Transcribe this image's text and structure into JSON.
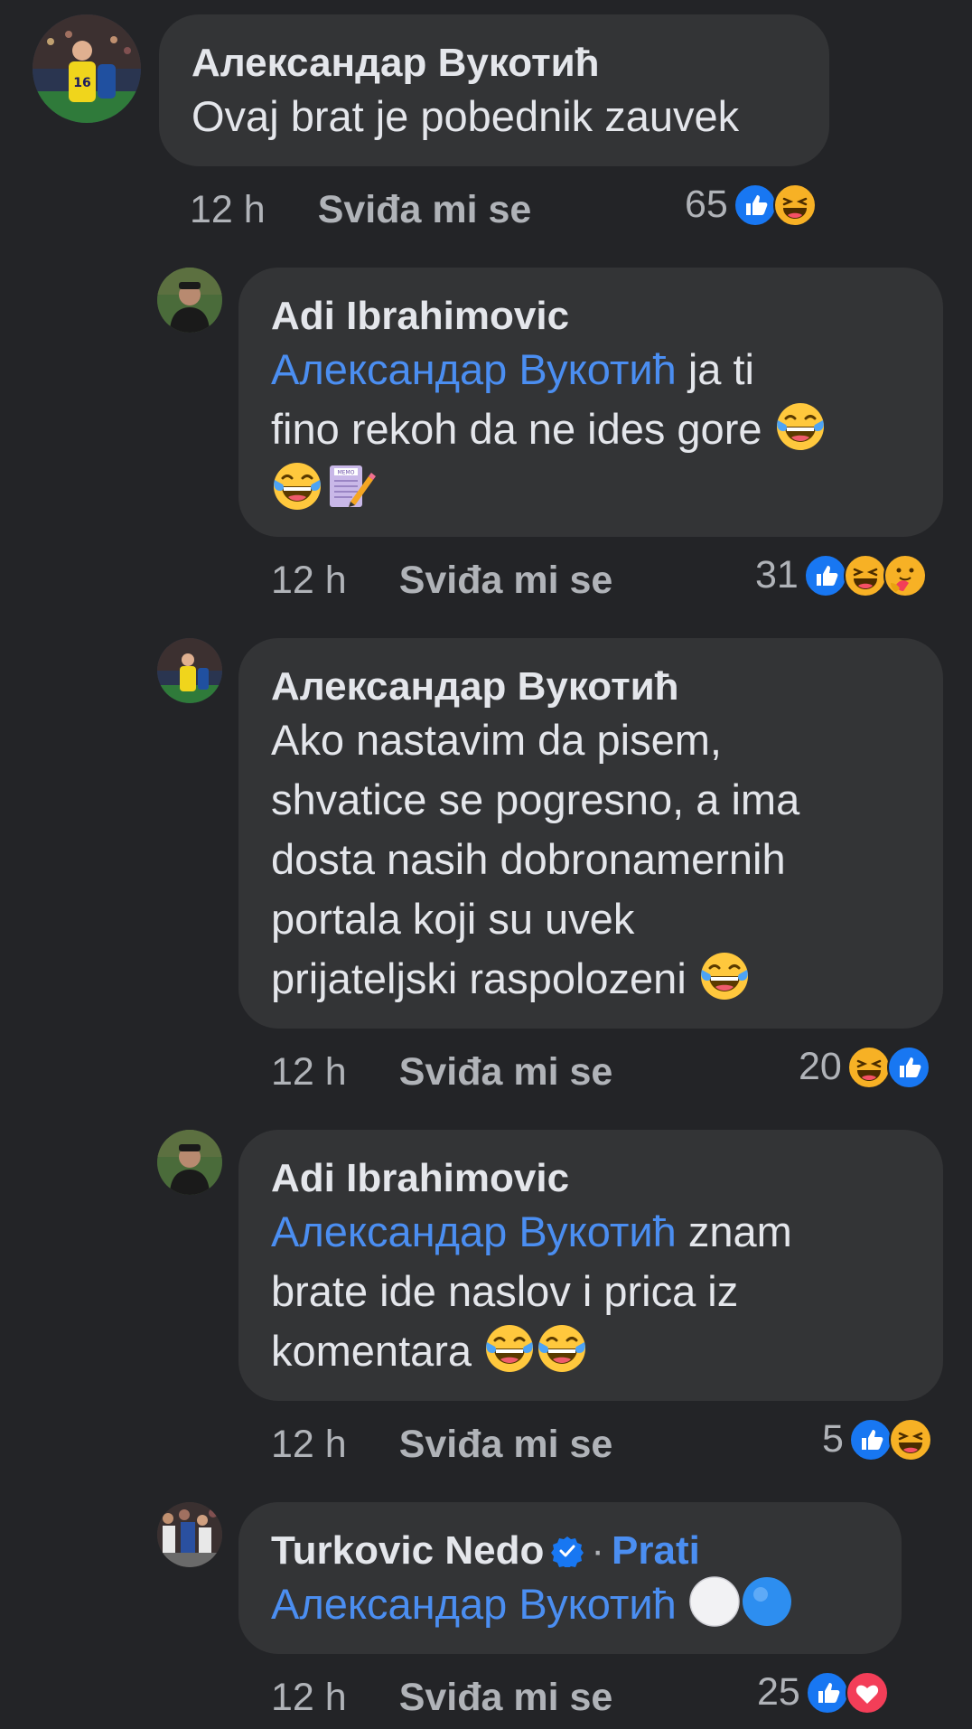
{
  "comments": [
    {
      "author": "Александар Вукотић",
      "text": "Ovaj brat je pobednik zauvek",
      "time": "12 h",
      "like_label": "Sviđa mi se",
      "reaction_count": "65",
      "reactions": [
        "like",
        "haha"
      ]
    },
    {
      "author": "Adi Ibrahimovic",
      "mention": "Александар Вукотић",
      "text_line1_after_mention": " ja ti",
      "text_line2": "fino rekoh da ne ides gore",
      "emojis": [
        "laughing-tears",
        "laughing-tears",
        "memo"
      ],
      "time": "12 h",
      "like_label": "Sviđa mi se",
      "reaction_count": "31",
      "reactions": [
        "like",
        "haha",
        "care"
      ]
    },
    {
      "author": "Александар Вукотић",
      "lines": [
        "Ako nastavim da pisem,",
        "shvatice se pogresno, a ima",
        "dosta nasih dobronamernih",
        "portala koji su uvek",
        "prijateljski raspolozeni"
      ],
      "emojis": [
        "laughing-tears"
      ],
      "time": "12 h",
      "like_label": "Sviđa mi se",
      "reaction_count": "20",
      "reactions": [
        "haha",
        "like"
      ]
    },
    {
      "author": "Adi Ibrahimovic",
      "mention": "Александар Вукотић",
      "text_line1_after_mention": " znam",
      "text_line2": "brate ide naslov i prica iz",
      "text_line3": "komentara",
      "emojis": [
        "laughing-tears",
        "laughing-tears"
      ],
      "time": "12 h",
      "like_label": "Sviđa mi se",
      "reaction_count": "5",
      "reactions": [
        "like",
        "haha"
      ]
    },
    {
      "author": "Turkovic Nedo",
      "verified": true,
      "separator": "·",
      "follow_label": "Prati",
      "mention": "Александар Вукотић",
      "emojis": [
        "white-circle",
        "blue-circle"
      ],
      "time": "12 h",
      "like_label": "Sviđa mi se",
      "reaction_count": "25",
      "reactions": [
        "like",
        "love"
      ]
    }
  ],
  "colors": {
    "background": "#232427",
    "bubble": "#333436",
    "mention": "#4b8ef1",
    "meta": "#b0b3b8",
    "like_reaction": "#1877f2",
    "love_reaction": "#f33e58",
    "haha_reaction": "#f7b125"
  }
}
